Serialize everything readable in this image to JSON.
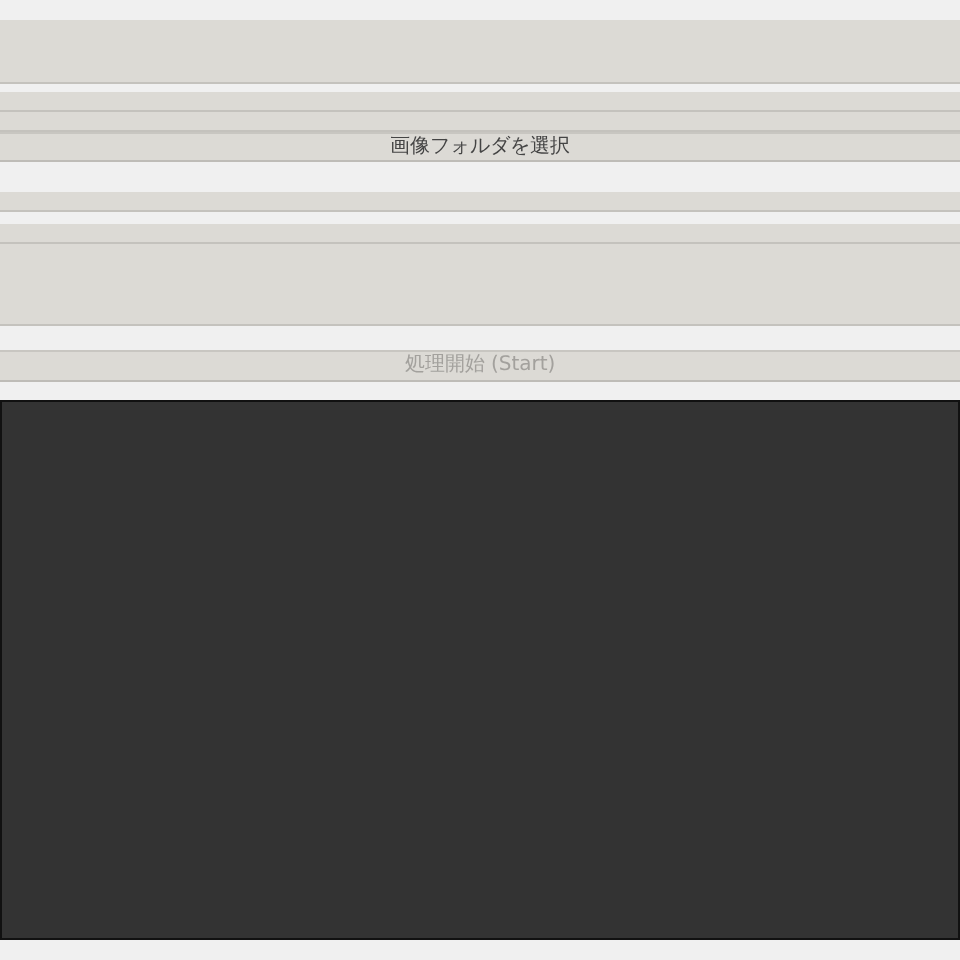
{
  "folder_button": {
    "label": "画像フォルダを選択",
    "disabled": false
  },
  "start_button": {
    "label": "処理開始 (Start)",
    "disabled": true
  }
}
